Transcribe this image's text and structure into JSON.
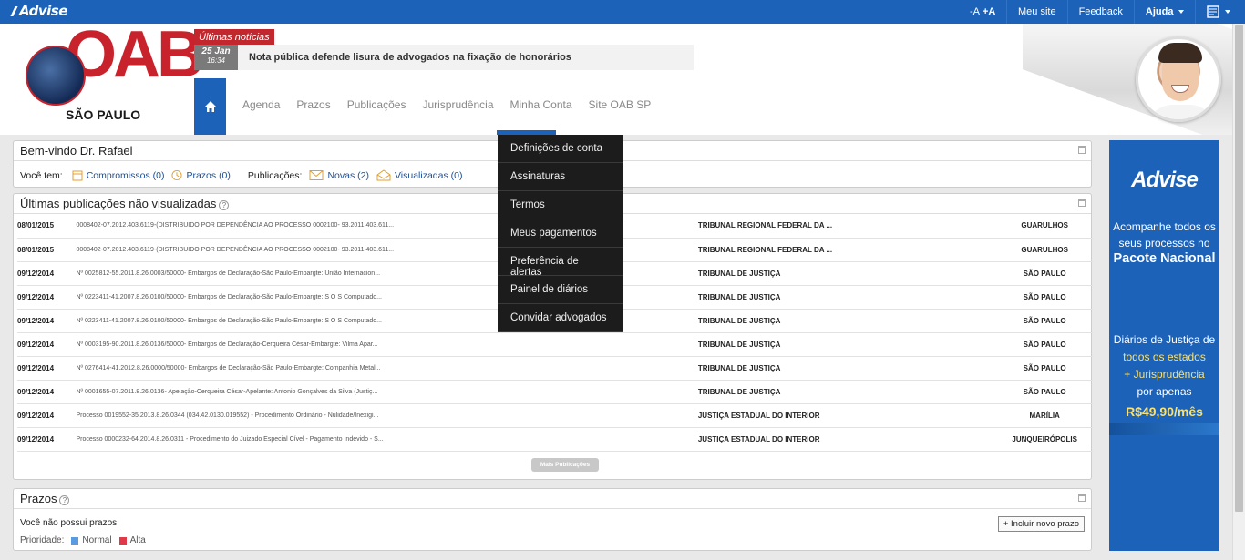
{
  "topbar": {
    "brand": "Advise",
    "font_minus": "-A",
    "font_plus": "+A",
    "my_site": "Meu site",
    "feedback": "Feedback",
    "help": "Ajuda"
  },
  "header": {
    "logo_text": "OAB",
    "logo_city": "SÃO PAULO",
    "news_label": "Últimas notícias",
    "news_date_day": "25 Jan",
    "news_date_time": "16:34",
    "news_title": "Nota pública defende lisura de advogados na fixação de honorários",
    "nav": [
      "Agenda",
      "Prazos",
      "Publicações",
      "Jurisprudência",
      "Minha Conta",
      "Site OAB SP"
    ]
  },
  "dropdown": [
    "Definições de conta",
    "Assinaturas",
    "Termos",
    "Meus pagamentos",
    "Preferência de alertas",
    "Painel de diários",
    "Convidar advogados"
  ],
  "welcome": {
    "title": "Bem-vindo Dr. Rafael",
    "you_have": "Você tem:",
    "compromissos": "Compromissos (0)",
    "prazos": "Prazos (0)",
    "publicacoes_label": "Publicações:",
    "novas": "Novas (2)",
    "visualizadas": "Visualizadas (0)"
  },
  "publications": {
    "title": "Últimas publicações não visualizadas",
    "more_button": "Mais Publicações",
    "rows": [
      {
        "date": "08/01/2015",
        "desc": "0008402-07.2012.403.6119-(DISTRIBUIDO POR DEPENDÊNCIA AO PROCESSO 0002100- 93.2011.403.611...",
        "court": "TRIBUNAL REGIONAL FEDERAL DA ...",
        "city": "GUARULHOS"
      },
      {
        "date": "08/01/2015",
        "desc": "0008402-07.2012.403.6119-(DISTRIBUIDO POR DEPENDÊNCIA AO PROCESSO 0002100- 93.2011.403.611...",
        "court": "TRIBUNAL REGIONAL FEDERAL DA ...",
        "city": "GUARULHOS"
      },
      {
        "date": "09/12/2014",
        "desc": "Nº 0025812-55.2011.8.26.0003/50000- Embargos de Declaração-São Paulo-Embargte: União Internacion...",
        "court": "TRIBUNAL DE JUSTIÇA",
        "city": "SÃO PAULO"
      },
      {
        "date": "09/12/2014",
        "desc": "Nº 0223411-41.2007.8.26.0100/50000- Embargos de Declaração-São Paulo-Embargte: S O S Computado...",
        "court": "TRIBUNAL DE JUSTIÇA",
        "city": "SÃO PAULO"
      },
      {
        "date": "09/12/2014",
        "desc": "Nº 0223411-41.2007.8.26.0100/50000- Embargos de Declaração-São Paulo-Embargte: S O S Computado...",
        "court": "TRIBUNAL DE JUSTIÇA",
        "city": "SÃO PAULO"
      },
      {
        "date": "09/12/2014",
        "desc": "Nº 0003195-90.2011.8.26.0136/50000- Embargos de Declaração-Cerqueira César-Embargte: Vilma Apar...",
        "court": "TRIBUNAL DE JUSTIÇA",
        "city": "SÃO PAULO"
      },
      {
        "date": "09/12/2014",
        "desc": "Nº 0276414-41.2012.8.26.0000/50000- Embargos de Declaração-São Paulo-Embargte: Companhia Metal...",
        "court": "TRIBUNAL DE JUSTIÇA",
        "city": "SÃO PAULO"
      },
      {
        "date": "09/12/2014",
        "desc": "Nº 0001655-07.2011.8.26.0136- Apelação-Cerqueira César-Apelante: Antonio Gonçalves da Silva (Justiç...",
        "court": "TRIBUNAL DE JUSTIÇA",
        "city": "SÃO PAULO"
      },
      {
        "date": "09/12/2014",
        "desc": "Processo 0019552-35.2013.8.26.0344 (034.42.0130.019552) - Procedimento Ordinário - Nulidade/Inexigi...",
        "court": "JUSTIÇA ESTADUAL DO INTERIOR",
        "city": "MARÍLIA"
      },
      {
        "date": "09/12/2014",
        "desc": "Processo 0000232-64.2014.8.26.0311 - Procedimento do Juizado Especial Cível - Pagamento Indevido - S...",
        "court": "JUSTIÇA ESTADUAL DO INTERIOR",
        "city": "JUNQUEIRÓPOLIS"
      }
    ]
  },
  "prazos": {
    "title": "Prazos",
    "empty": "Você não possui prazos.",
    "add_button": "+ Incluir novo prazo",
    "priority_label": "Prioridade:",
    "normal": "Normal",
    "alta": "Alta",
    "normal_color": "#5a9be0",
    "alta_color": "#e03a4a"
  },
  "ad": {
    "logo": "Advise",
    "line1": "Acompanhe todos os seus processos no",
    "line2": "Pacote Nacional",
    "line3": "Diários de Justiça de",
    "line4": "todos os estados",
    "line5": "+ Jurisprudência",
    "line6": "por apenas",
    "price": "R$49,90/mês"
  },
  "colors": {
    "brand_blue": "#1b62b8",
    "oab_red": "#c8232c"
  }
}
